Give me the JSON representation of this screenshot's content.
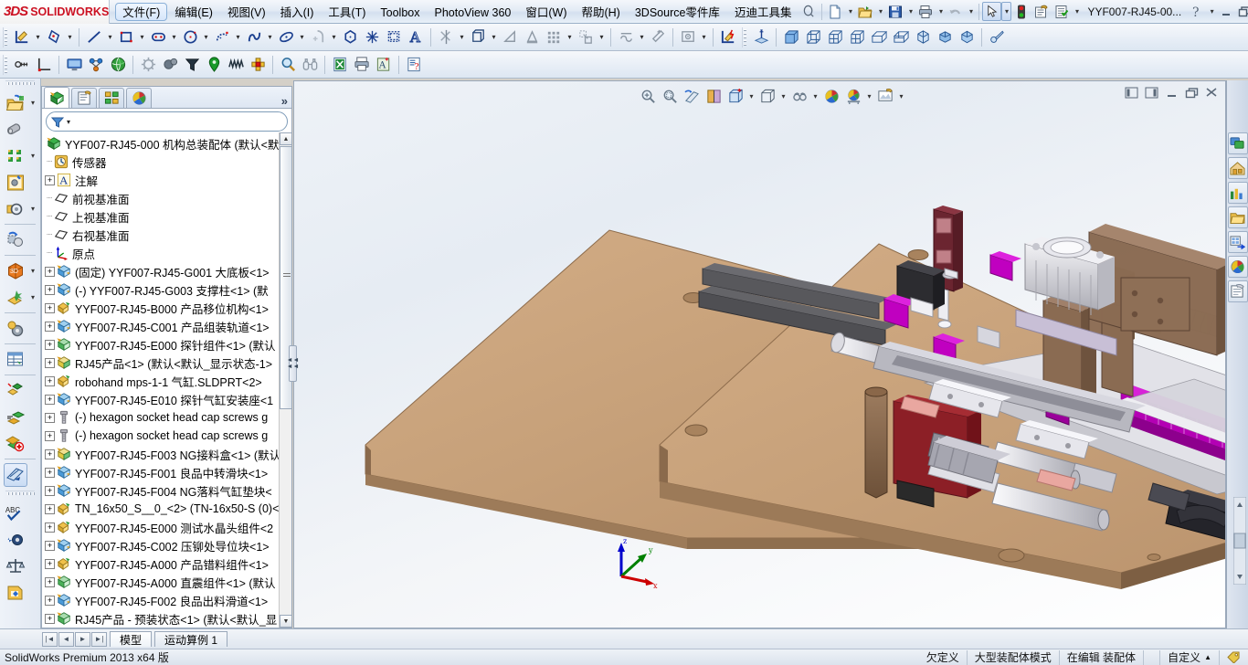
{
  "app": {
    "brand_3ds": "3DS",
    "brand_name": "SOLIDWORKS",
    "document_name": "YYF007-RJ45-00...",
    "status_product": "SolidWorks Premium 2013 x64 版"
  },
  "menu": {
    "items": [
      {
        "label": "文件(F)",
        "active": true
      },
      {
        "label": "编辑(E)",
        "active": false
      },
      {
        "label": "视图(V)",
        "active": false
      },
      {
        "label": "插入(I)",
        "active": false
      },
      {
        "label": "工具(T)",
        "active": false
      },
      {
        "label": "Toolbox",
        "active": false
      },
      {
        "label": "PhotoView 360",
        "active": false
      },
      {
        "label": "窗口(W)",
        "active": false
      },
      {
        "label": "帮助(H)",
        "active": false
      },
      {
        "label": "3DSource零件库",
        "active": false
      },
      {
        "label": "迈迪工具集",
        "active": false
      }
    ]
  },
  "quick_access": {
    "icons": [
      "pin-icon",
      "new-document-icon",
      "open-folder-icon",
      "save-icon",
      "print-icon",
      "undo-icon",
      "select-arrow-icon",
      "rebuild-icon",
      "options-icon",
      "document-properties-icon"
    ],
    "help_icon": "help-icon",
    "minimize_icon": "minimize-icon",
    "restore_icon": "restore-icon",
    "close_icon": "close-icon"
  },
  "toolbar_row1": {
    "icons": [
      "sketch-icon",
      "smart-dimension-icon",
      "line-icon",
      "rectangle-icon",
      "slot-icon",
      "circle-icon",
      "arc-icon",
      "spline-icon",
      "ellipse-icon",
      "fillet-icon",
      "polygon-icon",
      "point-icon",
      "offset-entities-icon",
      "text-icon",
      "trim-entities-icon",
      "linear-pattern-icon",
      "convert-entities-icon",
      "mirror-icon",
      "display-grid-icon",
      "move-entities-icon",
      "sketch-relation-icon",
      "repair-sketch-icon",
      "quick-snaps-icon",
      "rapid-sketch-icon",
      "reference-geometry-icon",
      "view-front-icon",
      "view-back-icon",
      "view-left-icon",
      "view-right-icon",
      "view-top-icon",
      "view-bottom-icon",
      "view-iso-icon",
      "view-dimetric-icon",
      "view-trimetric-icon",
      "section-view-icon"
    ]
  },
  "toolbar_row2": {
    "icons": [
      "measure-icon",
      "mass-properties-icon",
      "display-manager-icon",
      "assembly-visualization-icon",
      "globe-icon",
      "gear-settings-icon",
      "motion-study-icon",
      "funnel-icon",
      "marker-icon",
      "spring-icon",
      "interference-icon",
      "zoom-search-icon",
      "binoculars-icon",
      "excel-export-icon",
      "printer-icon",
      "annotation-icon",
      "checklist-icon"
    ]
  },
  "left_toolbar": {
    "icons": [
      "insert-components-icon",
      "mate-icon",
      "linear-component-pattern-icon",
      "smart-fasteners-icon",
      "move-component-icon",
      "show-hidden-icon",
      "assembly-features-icon",
      "reference-geometry-icon",
      "new-motion-study-icon",
      "bill-of-materials-icon",
      "exploded-view-icon",
      "explode-line-sketch-icon",
      "interference-detection-icon",
      "clearance-verification-icon",
      "hole-alignment-icon",
      "assembly-xpert-icon",
      "section-view-icon",
      "spell-check-icon",
      "measure-tape-icon",
      "mass-balance-icon",
      "sensor-icon"
    ]
  },
  "feature_manager": {
    "tabs": [
      "feature-tree-tab",
      "property-manager-tab",
      "configuration-manager-tab",
      "display-manager-tab"
    ],
    "more_label": "»",
    "filter_placeholder": "",
    "tree": [
      {
        "indent": 0,
        "expand": "none",
        "icon": "assembly-icon",
        "label": "YYF007-RJ45-000   机构总装配体  (默认<默"
      },
      {
        "indent": 1,
        "expand": "none",
        "icon": "sensor-icon",
        "label": "传感器"
      },
      {
        "indent": 1,
        "expand": "plus",
        "icon": "annotation-icon",
        "label": "注解"
      },
      {
        "indent": 1,
        "expand": "none",
        "icon": "plane-icon",
        "label": "前视基准面"
      },
      {
        "indent": 1,
        "expand": "none",
        "icon": "plane-icon",
        "label": "上视基准面"
      },
      {
        "indent": 1,
        "expand": "none",
        "icon": "plane-icon",
        "label": "右视基准面"
      },
      {
        "indent": 1,
        "expand": "none",
        "icon": "origin-icon",
        "label": "原点"
      },
      {
        "indent": 1,
        "expand": "plus",
        "icon": "part-blue-icon",
        "label": "(固定) YYF007-RJ45-G001   大底板<1>"
      },
      {
        "indent": 1,
        "expand": "plus",
        "icon": "part-blue-icon",
        "label": "(-) YYF007-RJ45-G003   支撑柱<1> (默"
      },
      {
        "indent": 1,
        "expand": "plus",
        "icon": "subassembly-icon",
        "label": "YYF007-RJ45-B000   产品移位机构<1>"
      },
      {
        "indent": 1,
        "expand": "plus",
        "icon": "part-blue-icon",
        "label": "YYF007-RJ45-C001   产品组装轨道<1>"
      },
      {
        "indent": 1,
        "expand": "plus",
        "icon": "part-green-icon",
        "label": "YYF007-RJ45-E000   探针组件<1> (默认"
      },
      {
        "indent": 1,
        "expand": "plus",
        "icon": "part-yellow-icon",
        "label": "RJ45产品<1> (默认<默认_显示状态-1>"
      },
      {
        "indent": 1,
        "expand": "plus",
        "icon": "subassembly-icon",
        "label": "robohand mps-1-1 气缸.SLDPRT<2>"
      },
      {
        "indent": 1,
        "expand": "plus",
        "icon": "part-blue-icon",
        "label": "YYF007-RJ45-E010   探针气缸安装座<1"
      },
      {
        "indent": 1,
        "expand": "plus",
        "icon": "screw-icon",
        "label": "(-) hexagon socket head cap screws g"
      },
      {
        "indent": 1,
        "expand": "plus",
        "icon": "screw-icon",
        "label": "(-) hexagon socket head cap screws g"
      },
      {
        "indent": 1,
        "expand": "plus",
        "icon": "part-yellow-icon",
        "label": "YYF007-RJ45-F003 NG接料盒<1>  (默认"
      },
      {
        "indent": 1,
        "expand": "plus",
        "icon": "part-blue-icon",
        "label": "YYF007-RJ45-F001   良品中转滑块<1>"
      },
      {
        "indent": 1,
        "expand": "plus",
        "icon": "part-blue-icon",
        "label": "YYF007-RJ45-F004   NG落料气缸垫块<"
      },
      {
        "indent": 1,
        "expand": "plus",
        "icon": "subassembly-icon",
        "label": "TN_16x50_S__0_<2> (TN-16x50-S (0)<"
      },
      {
        "indent": 1,
        "expand": "plus",
        "icon": "subassembly-icon",
        "label": "YYF007-RJ45-E000   测试水晶头组件<2"
      },
      {
        "indent": 1,
        "expand": "plus",
        "icon": "part-blue-icon",
        "label": "YYF007-RJ45-C002   压铆处导位块<1>"
      },
      {
        "indent": 1,
        "expand": "plus",
        "icon": "subassembly-icon",
        "label": "YYF007-RJ45-A000   产品错料组件<1>"
      },
      {
        "indent": 1,
        "expand": "plus",
        "icon": "part-green-icon",
        "label": "YYF007-RJ45-A000   直震组件<1> (默认"
      },
      {
        "indent": 1,
        "expand": "plus",
        "icon": "part-blue-icon",
        "label": "YYF007-RJ45-F002   良品出料滑道<1>"
      },
      {
        "indent": 1,
        "expand": "plus",
        "icon": "part-green-icon",
        "label": "RJ45产品 - 预装状态<1> (默认<默认_显"
      }
    ]
  },
  "graphics_toolbar": {
    "icons": [
      "zoom-to-fit-icon",
      "zoom-to-area-icon",
      "previous-view-icon",
      "section-view-icon",
      "view-orientation-icon",
      "display-style-icon",
      "hide-show-items-icon",
      "edit-appearance-icon",
      "apply-scene-icon",
      "view-settings-icon"
    ],
    "window_buttons": [
      "tile-left-icon",
      "tile-right-icon",
      "minimize-icon",
      "restore-icon",
      "close-icon"
    ]
  },
  "task_pane": {
    "buttons": [
      "solidworks-resources-icon",
      "design-library-icon",
      "file-explorer-icon",
      "search-icon",
      "view-palette-icon",
      "appearances-scenes-icon",
      "custom-properties-icon"
    ]
  },
  "triad": {
    "x_label": "x",
    "y_label": "y",
    "z_label": "z",
    "x_color": "#cc0000",
    "y_color": "#008000",
    "z_color": "#0000cc"
  },
  "bottom_tabs": {
    "nav": [
      "first-tab-icon",
      "prev-tab-icon",
      "next-tab-icon",
      "last-tab-icon"
    ],
    "tabs": [
      {
        "label": "模型",
        "active": true
      },
      {
        "label": "运动算例 1",
        "active": false
      }
    ]
  },
  "status_bar": {
    "left": "SolidWorks Premium 2013 x64 版",
    "cells": [
      "欠定义",
      "大型装配体模式",
      "在编辑 装配体",
      "",
      "自定义"
    ],
    "customize_caret": "▲",
    "tag_icon": "tag-icon"
  },
  "model_colors": {
    "base_plate": "#c9a47e",
    "base_plate_side": "#8a6a4c",
    "support_post": "#6e4b33",
    "bracket_brown": "#8a6b52",
    "red_block": "#8c1f26",
    "dark_gray": "#4d4d4d",
    "steel": "#d8d8dc",
    "magenta": "#cc00cc",
    "lavender": "#c6bcd6",
    "pink": "#e9a7a0",
    "maroon": "#6b2530",
    "black_part": "#2a2a2a"
  }
}
